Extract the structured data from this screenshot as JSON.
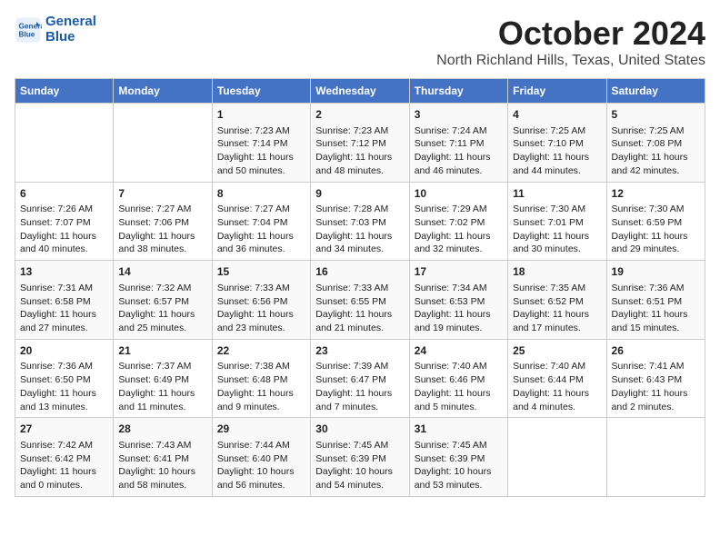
{
  "header": {
    "logo_line1": "General",
    "logo_line2": "Blue",
    "month": "October 2024",
    "location": "North Richland Hills, Texas, United States"
  },
  "days_of_week": [
    "Sunday",
    "Monday",
    "Tuesday",
    "Wednesday",
    "Thursday",
    "Friday",
    "Saturday"
  ],
  "weeks": [
    [
      {
        "day": "",
        "sunrise": "",
        "sunset": "",
        "daylight": ""
      },
      {
        "day": "",
        "sunrise": "",
        "sunset": "",
        "daylight": ""
      },
      {
        "day": "1",
        "sunrise": "Sunrise: 7:23 AM",
        "sunset": "Sunset: 7:14 PM",
        "daylight": "Daylight: 11 hours and 50 minutes."
      },
      {
        "day": "2",
        "sunrise": "Sunrise: 7:23 AM",
        "sunset": "Sunset: 7:12 PM",
        "daylight": "Daylight: 11 hours and 48 minutes."
      },
      {
        "day": "3",
        "sunrise": "Sunrise: 7:24 AM",
        "sunset": "Sunset: 7:11 PM",
        "daylight": "Daylight: 11 hours and 46 minutes."
      },
      {
        "day": "4",
        "sunrise": "Sunrise: 7:25 AM",
        "sunset": "Sunset: 7:10 PM",
        "daylight": "Daylight: 11 hours and 44 minutes."
      },
      {
        "day": "5",
        "sunrise": "Sunrise: 7:25 AM",
        "sunset": "Sunset: 7:08 PM",
        "daylight": "Daylight: 11 hours and 42 minutes."
      }
    ],
    [
      {
        "day": "6",
        "sunrise": "Sunrise: 7:26 AM",
        "sunset": "Sunset: 7:07 PM",
        "daylight": "Daylight: 11 hours and 40 minutes."
      },
      {
        "day": "7",
        "sunrise": "Sunrise: 7:27 AM",
        "sunset": "Sunset: 7:06 PM",
        "daylight": "Daylight: 11 hours and 38 minutes."
      },
      {
        "day": "8",
        "sunrise": "Sunrise: 7:27 AM",
        "sunset": "Sunset: 7:04 PM",
        "daylight": "Daylight: 11 hours and 36 minutes."
      },
      {
        "day": "9",
        "sunrise": "Sunrise: 7:28 AM",
        "sunset": "Sunset: 7:03 PM",
        "daylight": "Daylight: 11 hours and 34 minutes."
      },
      {
        "day": "10",
        "sunrise": "Sunrise: 7:29 AM",
        "sunset": "Sunset: 7:02 PM",
        "daylight": "Daylight: 11 hours and 32 minutes."
      },
      {
        "day": "11",
        "sunrise": "Sunrise: 7:30 AM",
        "sunset": "Sunset: 7:01 PM",
        "daylight": "Daylight: 11 hours and 30 minutes."
      },
      {
        "day": "12",
        "sunrise": "Sunrise: 7:30 AM",
        "sunset": "Sunset: 6:59 PM",
        "daylight": "Daylight: 11 hours and 29 minutes."
      }
    ],
    [
      {
        "day": "13",
        "sunrise": "Sunrise: 7:31 AM",
        "sunset": "Sunset: 6:58 PM",
        "daylight": "Daylight: 11 hours and 27 minutes."
      },
      {
        "day": "14",
        "sunrise": "Sunrise: 7:32 AM",
        "sunset": "Sunset: 6:57 PM",
        "daylight": "Daylight: 11 hours and 25 minutes."
      },
      {
        "day": "15",
        "sunrise": "Sunrise: 7:33 AM",
        "sunset": "Sunset: 6:56 PM",
        "daylight": "Daylight: 11 hours and 23 minutes."
      },
      {
        "day": "16",
        "sunrise": "Sunrise: 7:33 AM",
        "sunset": "Sunset: 6:55 PM",
        "daylight": "Daylight: 11 hours and 21 minutes."
      },
      {
        "day": "17",
        "sunrise": "Sunrise: 7:34 AM",
        "sunset": "Sunset: 6:53 PM",
        "daylight": "Daylight: 11 hours and 19 minutes."
      },
      {
        "day": "18",
        "sunrise": "Sunrise: 7:35 AM",
        "sunset": "Sunset: 6:52 PM",
        "daylight": "Daylight: 11 hours and 17 minutes."
      },
      {
        "day": "19",
        "sunrise": "Sunrise: 7:36 AM",
        "sunset": "Sunset: 6:51 PM",
        "daylight": "Daylight: 11 hours and 15 minutes."
      }
    ],
    [
      {
        "day": "20",
        "sunrise": "Sunrise: 7:36 AM",
        "sunset": "Sunset: 6:50 PM",
        "daylight": "Daylight: 11 hours and 13 minutes."
      },
      {
        "day": "21",
        "sunrise": "Sunrise: 7:37 AM",
        "sunset": "Sunset: 6:49 PM",
        "daylight": "Daylight: 11 hours and 11 minutes."
      },
      {
        "day": "22",
        "sunrise": "Sunrise: 7:38 AM",
        "sunset": "Sunset: 6:48 PM",
        "daylight": "Daylight: 11 hours and 9 minutes."
      },
      {
        "day": "23",
        "sunrise": "Sunrise: 7:39 AM",
        "sunset": "Sunset: 6:47 PM",
        "daylight": "Daylight: 11 hours and 7 minutes."
      },
      {
        "day": "24",
        "sunrise": "Sunrise: 7:40 AM",
        "sunset": "Sunset: 6:46 PM",
        "daylight": "Daylight: 11 hours and 5 minutes."
      },
      {
        "day": "25",
        "sunrise": "Sunrise: 7:40 AM",
        "sunset": "Sunset: 6:44 PM",
        "daylight": "Daylight: 11 hours and 4 minutes."
      },
      {
        "day": "26",
        "sunrise": "Sunrise: 7:41 AM",
        "sunset": "Sunset: 6:43 PM",
        "daylight": "Daylight: 11 hours and 2 minutes."
      }
    ],
    [
      {
        "day": "27",
        "sunrise": "Sunrise: 7:42 AM",
        "sunset": "Sunset: 6:42 PM",
        "daylight": "Daylight: 11 hours and 0 minutes."
      },
      {
        "day": "28",
        "sunrise": "Sunrise: 7:43 AM",
        "sunset": "Sunset: 6:41 PM",
        "daylight": "Daylight: 10 hours and 58 minutes."
      },
      {
        "day": "29",
        "sunrise": "Sunrise: 7:44 AM",
        "sunset": "Sunset: 6:40 PM",
        "daylight": "Daylight: 10 hours and 56 minutes."
      },
      {
        "day": "30",
        "sunrise": "Sunrise: 7:45 AM",
        "sunset": "Sunset: 6:39 PM",
        "daylight": "Daylight: 10 hours and 54 minutes."
      },
      {
        "day": "31",
        "sunrise": "Sunrise: 7:45 AM",
        "sunset": "Sunset: 6:39 PM",
        "daylight": "Daylight: 10 hours and 53 minutes."
      },
      {
        "day": "",
        "sunrise": "",
        "sunset": "",
        "daylight": ""
      },
      {
        "day": "",
        "sunrise": "",
        "sunset": "",
        "daylight": ""
      }
    ]
  ]
}
